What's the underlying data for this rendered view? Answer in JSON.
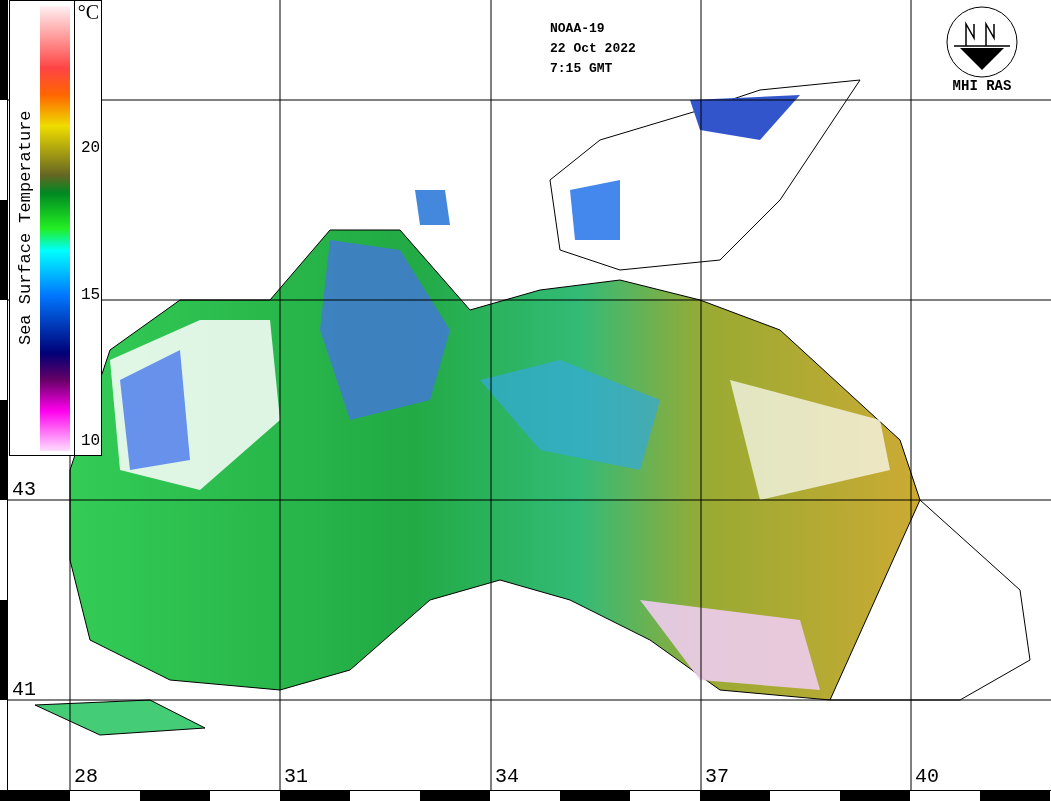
{
  "colorbar": {
    "title": "Sea Surface Temperature",
    "unit": "°C",
    "ticks": [
      "20",
      "15",
      "10"
    ]
  },
  "header": [
    "NOAA-19",
    "22 Oct 2022",
    "7:15 GMT"
  ],
  "logo": {
    "text": "MHI RAS"
  },
  "latitudes": [
    "43",
    "41"
  ],
  "longitudes": [
    "28",
    "31",
    "34",
    "37",
    "40"
  ]
}
